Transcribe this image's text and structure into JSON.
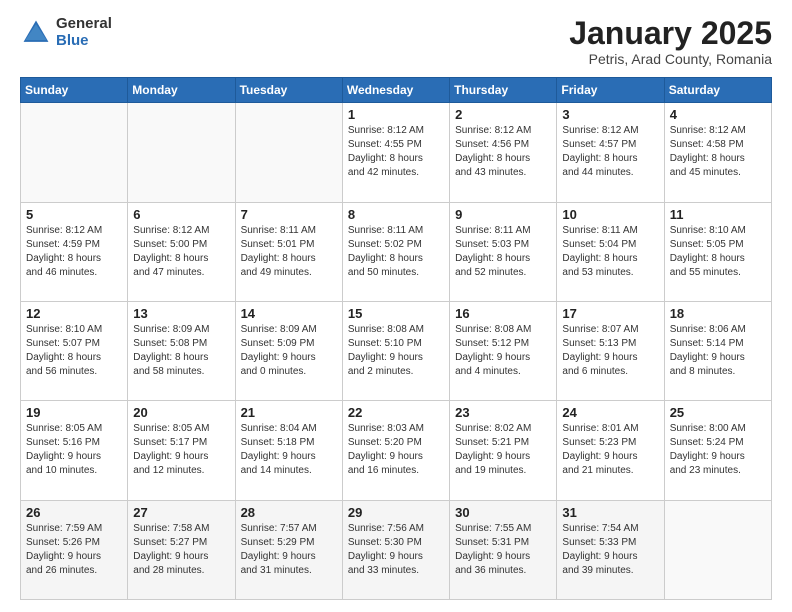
{
  "header": {
    "logo_general": "General",
    "logo_blue": "Blue",
    "month_title": "January 2025",
    "location": "Petris, Arad County, Romania"
  },
  "days_of_week": [
    "Sunday",
    "Monday",
    "Tuesday",
    "Wednesday",
    "Thursday",
    "Friday",
    "Saturday"
  ],
  "weeks": [
    [
      {
        "day": "",
        "info": ""
      },
      {
        "day": "",
        "info": ""
      },
      {
        "day": "",
        "info": ""
      },
      {
        "day": "1",
        "info": "Sunrise: 8:12 AM\nSunset: 4:55 PM\nDaylight: 8 hours\nand 42 minutes."
      },
      {
        "day": "2",
        "info": "Sunrise: 8:12 AM\nSunset: 4:56 PM\nDaylight: 8 hours\nand 43 minutes."
      },
      {
        "day": "3",
        "info": "Sunrise: 8:12 AM\nSunset: 4:57 PM\nDaylight: 8 hours\nand 44 minutes."
      },
      {
        "day": "4",
        "info": "Sunrise: 8:12 AM\nSunset: 4:58 PM\nDaylight: 8 hours\nand 45 minutes."
      }
    ],
    [
      {
        "day": "5",
        "info": "Sunrise: 8:12 AM\nSunset: 4:59 PM\nDaylight: 8 hours\nand 46 minutes."
      },
      {
        "day": "6",
        "info": "Sunrise: 8:12 AM\nSunset: 5:00 PM\nDaylight: 8 hours\nand 47 minutes."
      },
      {
        "day": "7",
        "info": "Sunrise: 8:11 AM\nSunset: 5:01 PM\nDaylight: 8 hours\nand 49 minutes."
      },
      {
        "day": "8",
        "info": "Sunrise: 8:11 AM\nSunset: 5:02 PM\nDaylight: 8 hours\nand 50 minutes."
      },
      {
        "day": "9",
        "info": "Sunrise: 8:11 AM\nSunset: 5:03 PM\nDaylight: 8 hours\nand 52 minutes."
      },
      {
        "day": "10",
        "info": "Sunrise: 8:11 AM\nSunset: 5:04 PM\nDaylight: 8 hours\nand 53 minutes."
      },
      {
        "day": "11",
        "info": "Sunrise: 8:10 AM\nSunset: 5:05 PM\nDaylight: 8 hours\nand 55 minutes."
      }
    ],
    [
      {
        "day": "12",
        "info": "Sunrise: 8:10 AM\nSunset: 5:07 PM\nDaylight: 8 hours\nand 56 minutes."
      },
      {
        "day": "13",
        "info": "Sunrise: 8:09 AM\nSunset: 5:08 PM\nDaylight: 8 hours\nand 58 minutes."
      },
      {
        "day": "14",
        "info": "Sunrise: 8:09 AM\nSunset: 5:09 PM\nDaylight: 9 hours\nand 0 minutes."
      },
      {
        "day": "15",
        "info": "Sunrise: 8:08 AM\nSunset: 5:10 PM\nDaylight: 9 hours\nand 2 minutes."
      },
      {
        "day": "16",
        "info": "Sunrise: 8:08 AM\nSunset: 5:12 PM\nDaylight: 9 hours\nand 4 minutes."
      },
      {
        "day": "17",
        "info": "Sunrise: 8:07 AM\nSunset: 5:13 PM\nDaylight: 9 hours\nand 6 minutes."
      },
      {
        "day": "18",
        "info": "Sunrise: 8:06 AM\nSunset: 5:14 PM\nDaylight: 9 hours\nand 8 minutes."
      }
    ],
    [
      {
        "day": "19",
        "info": "Sunrise: 8:05 AM\nSunset: 5:16 PM\nDaylight: 9 hours\nand 10 minutes."
      },
      {
        "day": "20",
        "info": "Sunrise: 8:05 AM\nSunset: 5:17 PM\nDaylight: 9 hours\nand 12 minutes."
      },
      {
        "day": "21",
        "info": "Sunrise: 8:04 AM\nSunset: 5:18 PM\nDaylight: 9 hours\nand 14 minutes."
      },
      {
        "day": "22",
        "info": "Sunrise: 8:03 AM\nSunset: 5:20 PM\nDaylight: 9 hours\nand 16 minutes."
      },
      {
        "day": "23",
        "info": "Sunrise: 8:02 AM\nSunset: 5:21 PM\nDaylight: 9 hours\nand 19 minutes."
      },
      {
        "day": "24",
        "info": "Sunrise: 8:01 AM\nSunset: 5:23 PM\nDaylight: 9 hours\nand 21 minutes."
      },
      {
        "day": "25",
        "info": "Sunrise: 8:00 AM\nSunset: 5:24 PM\nDaylight: 9 hours\nand 23 minutes."
      }
    ],
    [
      {
        "day": "26",
        "info": "Sunrise: 7:59 AM\nSunset: 5:26 PM\nDaylight: 9 hours\nand 26 minutes."
      },
      {
        "day": "27",
        "info": "Sunrise: 7:58 AM\nSunset: 5:27 PM\nDaylight: 9 hours\nand 28 minutes."
      },
      {
        "day": "28",
        "info": "Sunrise: 7:57 AM\nSunset: 5:29 PM\nDaylight: 9 hours\nand 31 minutes."
      },
      {
        "day": "29",
        "info": "Sunrise: 7:56 AM\nSunset: 5:30 PM\nDaylight: 9 hours\nand 33 minutes."
      },
      {
        "day": "30",
        "info": "Sunrise: 7:55 AM\nSunset: 5:31 PM\nDaylight: 9 hours\nand 36 minutes."
      },
      {
        "day": "31",
        "info": "Sunrise: 7:54 AM\nSunset: 5:33 PM\nDaylight: 9 hours\nand 39 minutes."
      },
      {
        "day": "",
        "info": ""
      }
    ]
  ]
}
